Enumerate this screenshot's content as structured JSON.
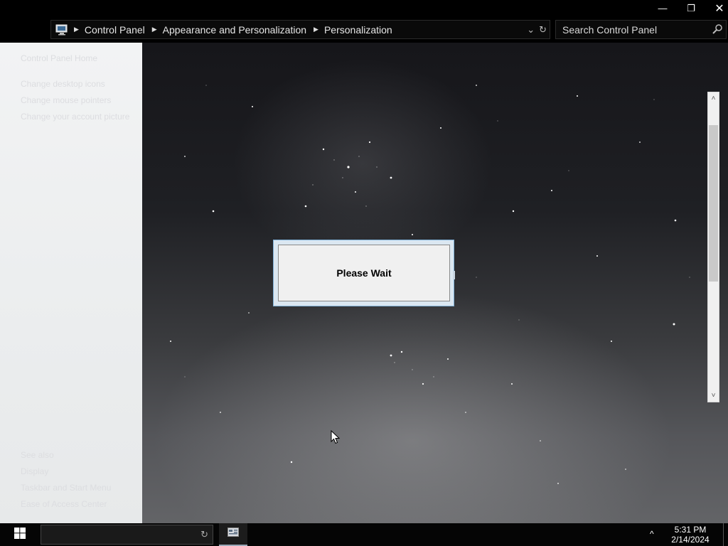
{
  "window": {
    "minimize_glyph": "—",
    "maximize_glyph": "❐",
    "close_glyph": "✕"
  },
  "address_bar": {
    "icon": "control-panel-icon",
    "breadcrumbs": [
      "Control Panel",
      "Appearance and Personalization",
      "Personalization"
    ],
    "dropdown_glyph": "⌄",
    "refresh_glyph": "↻"
  },
  "search": {
    "placeholder": "Search Control Panel",
    "icon": "search-icon"
  },
  "left_pane": {
    "home_link": "Control Panel Home",
    "tasks": [
      "Change desktop icons",
      "Change mouse pointers",
      "Change your account picture"
    ],
    "see_also_heading": "See also",
    "see_also_links": [
      "Display",
      "Taskbar and Start Menu",
      "Ease of Access Center"
    ]
  },
  "dialog": {
    "message": "Please Wait"
  },
  "scrollbar": {
    "up_glyph": "˄",
    "down_glyph": "˅"
  },
  "taskbar": {
    "start_icon": "windows-logo-icon",
    "search_refresh_glyph": "↻",
    "tray_glyph": "^",
    "time": "5:31 PM",
    "date": "2/14/2024"
  },
  "colors": {
    "titlebar": "#000000",
    "left_pane": "#eef0f1",
    "dialog_border": "#7fb0d6"
  }
}
